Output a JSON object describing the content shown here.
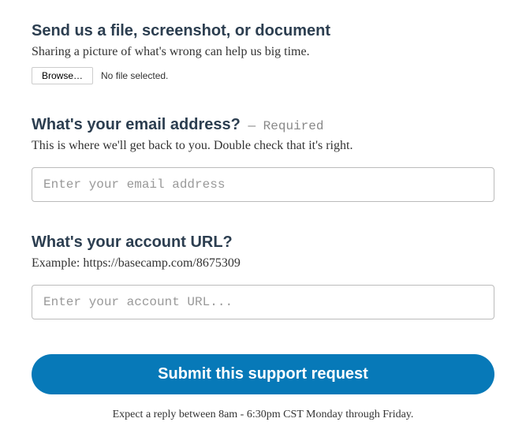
{
  "file_section": {
    "heading": "Send us a file, screenshot, or document",
    "description": "Sharing a picture of what's wrong can help us big time.",
    "browse_label": "Browse…",
    "status": "No file selected."
  },
  "email_section": {
    "heading": "What's your email address?",
    "required_prefix": " — ",
    "required_label": "Required",
    "description": "This is where we'll get back to you. Double check that it's right.",
    "placeholder": "Enter your email address"
  },
  "url_section": {
    "heading": "What's your account URL?",
    "description": "Example: https://basecamp.com/8675309",
    "placeholder": "Enter your account URL..."
  },
  "submit_label": "Submit this support request",
  "footer_note": "Expect a reply between 8am - 6:30pm CST Monday through Friday."
}
